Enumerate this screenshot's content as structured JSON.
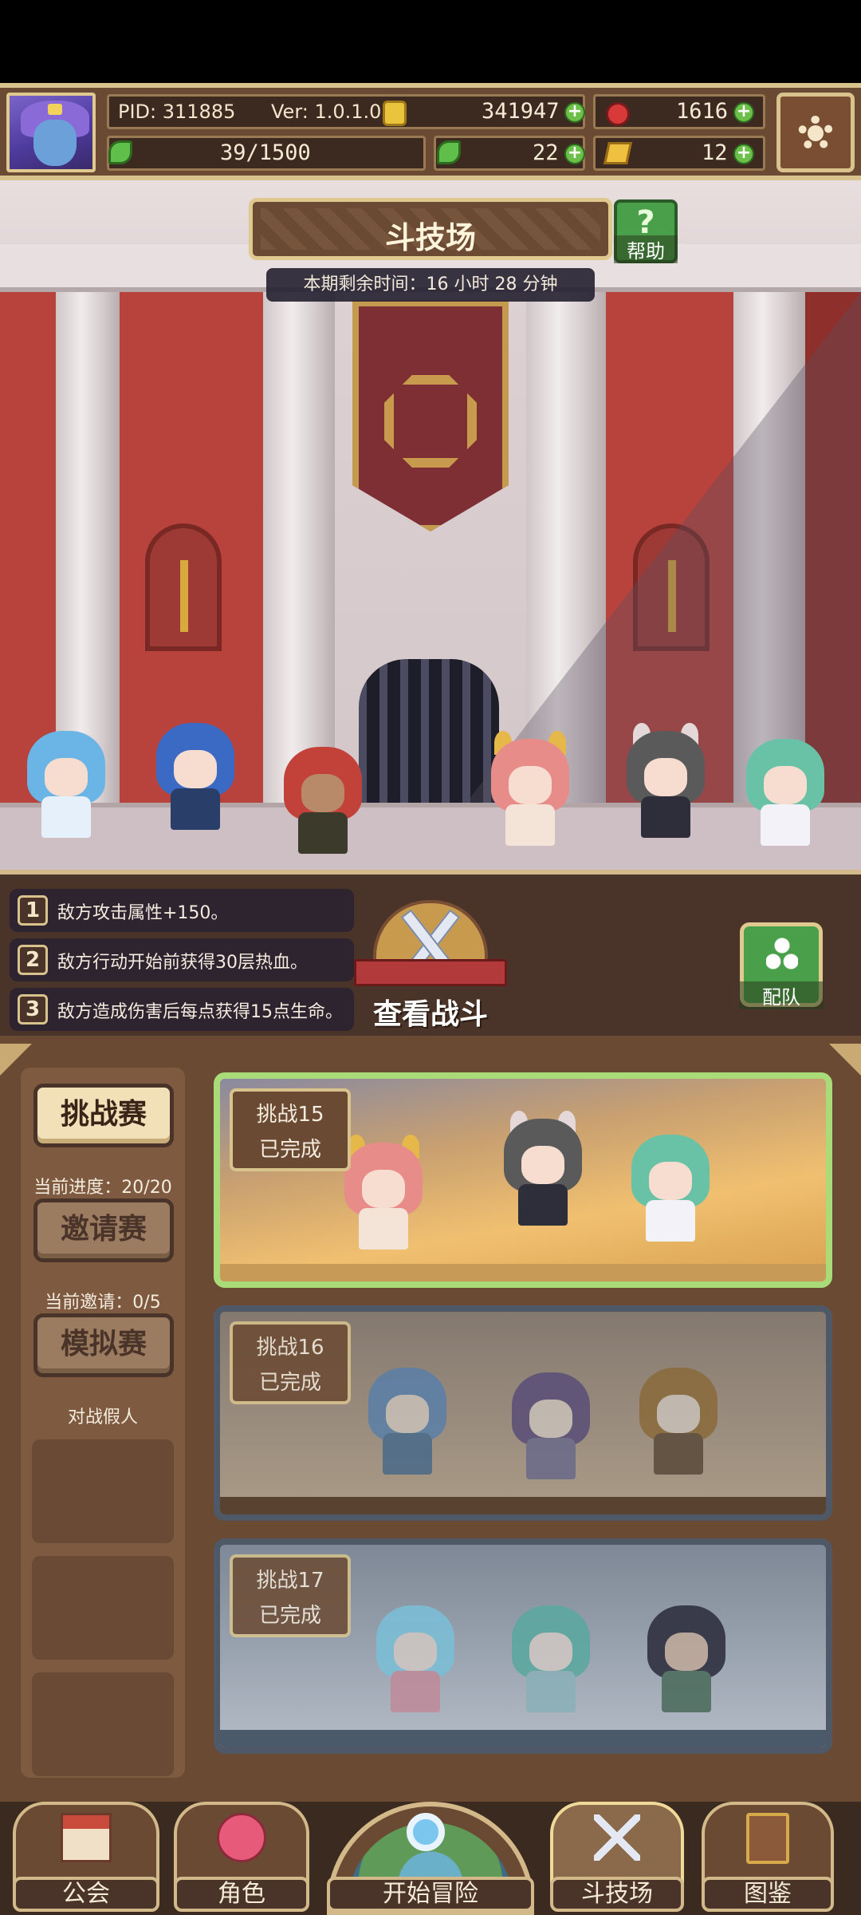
{
  "header": {
    "pid": "PID: 311885",
    "version": "Ver: 1.0.1.0",
    "gold": "341947",
    "gems": "1616",
    "stamina": "39/1500",
    "clovers": "22",
    "tickets": "12",
    "icons": [
      "avatar-portrait",
      "coin-icon",
      "ruby-icon",
      "clover-icon",
      "ticket-icon",
      "gear-icon",
      "plus-icon"
    ]
  },
  "arena": {
    "title": "斗技场",
    "help_label": "帮助",
    "help_glyph": "?",
    "timer": "本期剩余时间：16 小时 28 分钟"
  },
  "modifiers": [
    {
      "num": "1",
      "text": "敌方攻击属性+150。"
    },
    {
      "num": "2",
      "text": "敌方行动开始前获得30层热血。"
    },
    {
      "num": "3",
      "text": "敌方造成伤害后每点获得15点生命。"
    }
  ],
  "battle": {
    "view_label": "查看战斗",
    "team_label": "配队"
  },
  "modes": [
    {
      "label": "挑战赛",
      "sub": "当前进度：20/20",
      "active": true
    },
    {
      "label": "邀请赛",
      "sub": "当前邀请：0/5",
      "active": false
    },
    {
      "label": "模拟赛",
      "sub": "对战假人",
      "active": false
    }
  ],
  "challenges": [
    {
      "name": "挑战15",
      "status": "已完成",
      "highlight": true
    },
    {
      "name": "挑战16",
      "status": "已完成",
      "highlight": false
    },
    {
      "name": "挑战17",
      "status": "已完成",
      "highlight": false
    }
  ],
  "nav": [
    {
      "label": "公会",
      "icon": "guild-hall-icon"
    },
    {
      "label": "角色",
      "icon": "character-icon"
    },
    {
      "label": "开始冒险",
      "icon": "adventure-map-icon"
    },
    {
      "label": "斗技场",
      "icon": "crossed-swords-icon",
      "active": true
    },
    {
      "label": "图鉴",
      "icon": "codex-book-icon"
    }
  ],
  "colors": {
    "panel_brown": "#6b4a33",
    "gold_trim": "#d8c38d",
    "accent_green": "#4aa04a",
    "done_border": "#a9dc78",
    "arena_red": "#b8423c"
  }
}
